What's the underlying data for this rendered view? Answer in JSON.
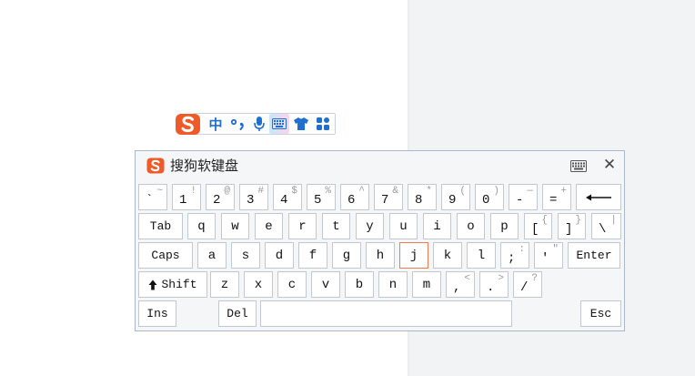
{
  "ime_toolbar": {
    "logo": "sogou-s-logo",
    "lang": "中",
    "punct": "°,",
    "icons": [
      "voice-icon",
      "soft-keyboard-icon",
      "skin-icon",
      "toolbox-icon"
    ]
  },
  "soft_keyboard": {
    "title": "搜狗软键盘",
    "rows": [
      [
        {
          "lower": "`",
          "upper": "~"
        },
        {
          "lower": "1",
          "upper": "!"
        },
        {
          "lower": "2",
          "upper": "@"
        },
        {
          "lower": "3",
          "upper": "#"
        },
        {
          "lower": "4",
          "upper": "$"
        },
        {
          "lower": "5",
          "upper": "%"
        },
        {
          "lower": "6",
          "upper": "^"
        },
        {
          "lower": "7",
          "upper": "&"
        },
        {
          "lower": "8",
          "upper": "*"
        },
        {
          "lower": "9",
          "upper": "("
        },
        {
          "lower": "0",
          "upper": ")"
        },
        {
          "lower": "-",
          "upper": "—"
        },
        {
          "lower": "=",
          "upper": "+"
        },
        {
          "icon": "backspace-arrow-icon"
        }
      ],
      [
        {
          "label": "Tab"
        },
        {
          "main": "q"
        },
        {
          "main": "w"
        },
        {
          "main": "e"
        },
        {
          "main": "r"
        },
        {
          "main": "t"
        },
        {
          "main": "y"
        },
        {
          "main": "u"
        },
        {
          "main": "i"
        },
        {
          "main": "o"
        },
        {
          "main": "p"
        },
        {
          "lower": "[",
          "upper": "{"
        },
        {
          "lower": "]",
          "upper": "}"
        },
        {
          "lower": "\\",
          "upper": "|"
        }
      ],
      [
        {
          "label": "Caps"
        },
        {
          "main": "a"
        },
        {
          "main": "s"
        },
        {
          "main": "d"
        },
        {
          "main": "f"
        },
        {
          "main": "g"
        },
        {
          "main": "h"
        },
        {
          "main": "j",
          "active": true
        },
        {
          "main": "k"
        },
        {
          "main": "l"
        },
        {
          "lower": ";",
          "upper": ":"
        },
        {
          "lower": "'",
          "upper": "\""
        },
        {
          "label": "Enter"
        }
      ],
      [
        {
          "label": "Shift",
          "icon": "shift-arrow-icon"
        },
        {
          "main": "z"
        },
        {
          "main": "x"
        },
        {
          "main": "c"
        },
        {
          "main": "v"
        },
        {
          "main": "b"
        },
        {
          "main": "n"
        },
        {
          "main": "m"
        },
        {
          "lower": ",",
          "upper": "<"
        },
        {
          "lower": ".",
          "upper": ">"
        },
        {
          "lower": "/",
          "upper": "?"
        }
      ],
      [
        {
          "label": "Ins"
        },
        {
          "label": "Del"
        },
        {
          "label": ""
        },
        {
          "label": "Esc"
        }
      ]
    ],
    "colors": {
      "brand_red": "#ef5a28",
      "ime_blue": "#1f6fd1",
      "active_key_border": "#ee7c52"
    }
  }
}
